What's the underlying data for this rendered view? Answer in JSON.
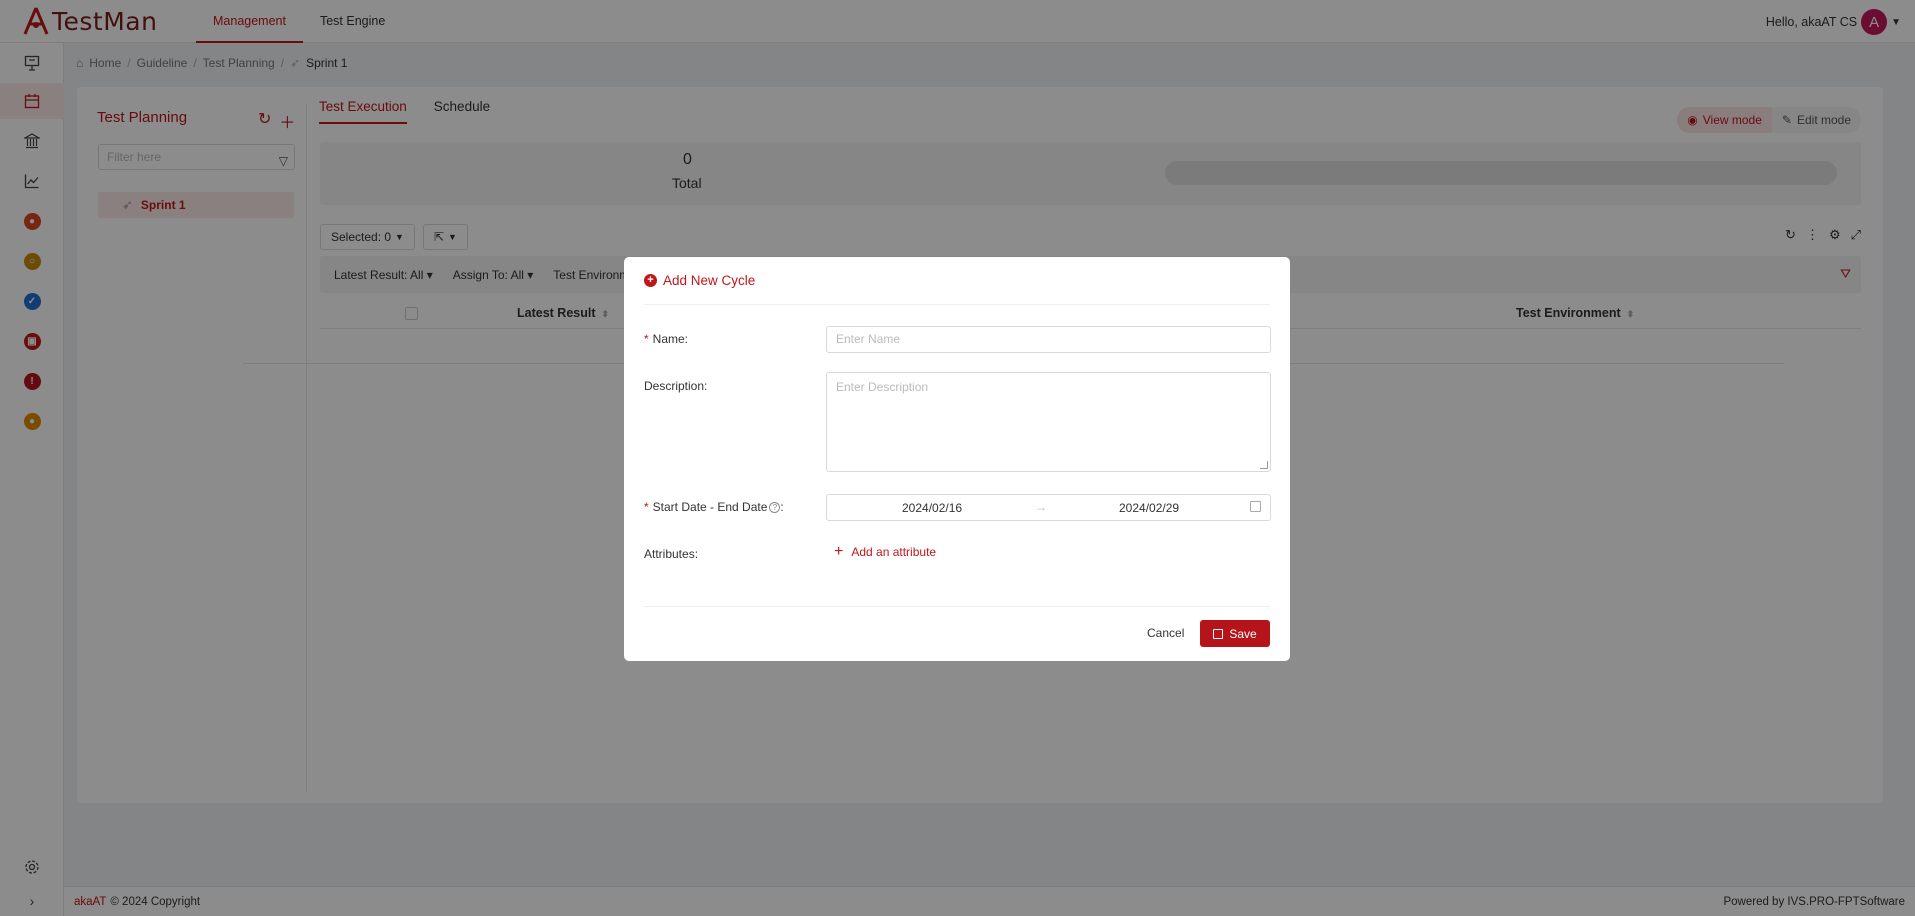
{
  "header": {
    "logo_text": "TestMan",
    "nav": [
      {
        "label": "Management",
        "active": true
      },
      {
        "label": "Test Engine",
        "active": false
      }
    ],
    "greeting": "Hello, akaAT CS",
    "avatar_letter": "A"
  },
  "sidebar": {
    "icons": [
      "presentation-icon",
      "calendar-icon",
      "library-icon",
      "chart-icon",
      "people-icon",
      "badge-icon",
      "check-icon",
      "building-icon",
      "alert-icon",
      "record-icon"
    ],
    "bottom_icons": [
      "settings-icon",
      "expand-icon"
    ]
  },
  "breadcrumb": [
    "Home",
    "Guideline",
    "Test Planning",
    "Sprint 1"
  ],
  "test_planning": {
    "title": "Test Planning",
    "filter_placeholder": "Filter here",
    "tree": [
      {
        "label": "Sprint 1"
      }
    ]
  },
  "tabs": [
    {
      "label": "Test Execution",
      "active": true
    },
    {
      "label": "Schedule",
      "active": false
    }
  ],
  "modes": {
    "view": "View mode",
    "edit": "Edit mode"
  },
  "stats": {
    "total_value": "0",
    "total_label": "Total"
  },
  "toolbar": {
    "selected": "Selected: 0"
  },
  "filters": [
    "Latest Result: All",
    "Assign To: All",
    "Test Environm"
  ],
  "table": {
    "columns": [
      "Latest Result",
      "Test Environment"
    ]
  },
  "footer": {
    "brand": "akaAT",
    "copyright": "© 2024 Copyright",
    "powered_prefix": "Powered by ",
    "powered_brand": "IVS.PRO-FPTSoftware"
  },
  "modal": {
    "title": "Add New Cycle",
    "name_label": "Name:",
    "name_placeholder": "Enter Name",
    "description_label": "Description:",
    "description_placeholder": "Enter Description",
    "date_label": "Start Date - End Date",
    "date_colon": ":",
    "start_date": "2024/02/16",
    "end_date": "2024/02/29",
    "range_arrow": "→",
    "attributes_label": "Attributes:",
    "add_attribute": "Add an attribute",
    "cancel": "Cancel",
    "save": "Save"
  },
  "colors": {
    "accent": "#c0161b",
    "avatar": "#c2185b"
  }
}
